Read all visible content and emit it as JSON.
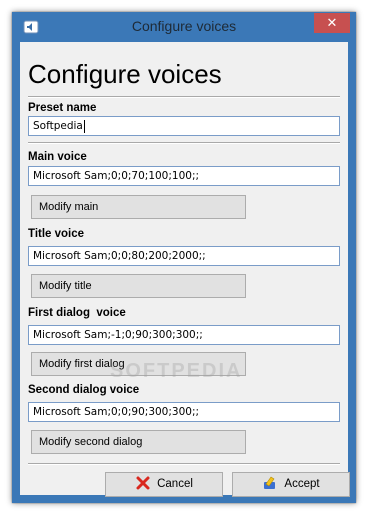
{
  "window": {
    "title": "Configure voices",
    "app_icon": "speaker-icon",
    "close_glyph": "✕"
  },
  "heading": "Configure voices",
  "preset": {
    "label": "Preset name",
    "value": "Softpedia"
  },
  "main_voice": {
    "label": "Main voice",
    "value": "Microsoft Sam;0;0;70;100;100;;",
    "button": "Modify main"
  },
  "title_voice": {
    "label": "Title voice",
    "value": "Microsoft Sam;0;0;80;200;2000;;",
    "button": "Modify title"
  },
  "first_dialog_voice": {
    "label": "First dialog  voice",
    "value": "Microsoft Sam;-1;0;90;300;300;;",
    "button": "Modify first dialog"
  },
  "second_dialog_voice": {
    "label": "Second dialog voice",
    "value": "Microsoft Sam;0;0;90;300;300;;",
    "button": "Modify second dialog"
  },
  "footer": {
    "cancel": "Cancel",
    "cancel_icon": "red-x-icon",
    "accept": "Accept",
    "accept_icon": "accept-icon"
  },
  "watermark": "SOFTPEDIA",
  "colors": {
    "frame": "#3b78b7",
    "close_button": "#c75050",
    "dialog_background": "#f0f0f0"
  }
}
